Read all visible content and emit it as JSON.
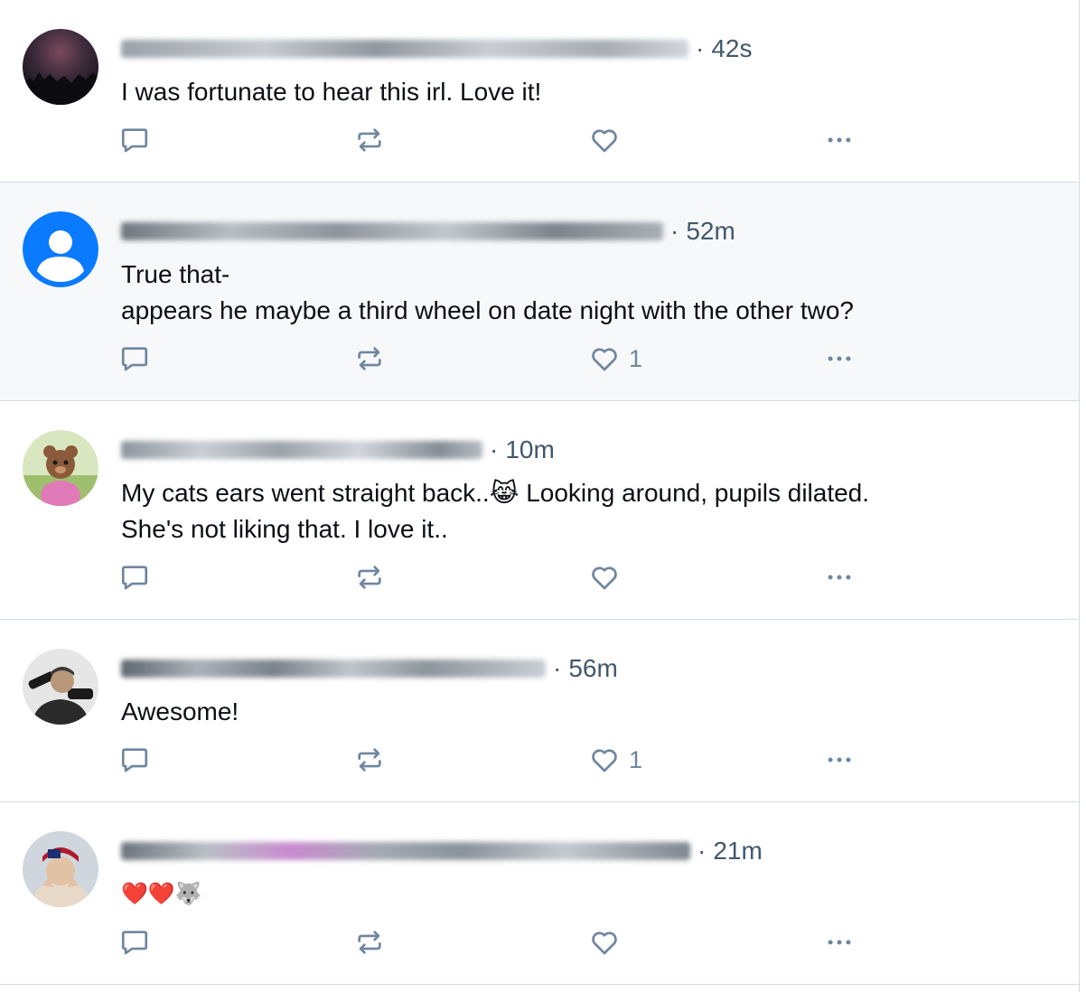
{
  "posts": [
    {
      "time": "42s",
      "text_lines": [
        "I was fortunate to hear this irl. Love it!"
      ],
      "like_count": "",
      "avatar": "night-sky-photo-avatar",
      "highlighted": false
    },
    {
      "time": "52m",
      "text_lines": [
        "True that-",
        "appears he maybe a third wheel on date night with the other two?"
      ],
      "like_count": "1",
      "avatar": "default-user-avatar",
      "highlighted": true
    },
    {
      "time": "10m",
      "text_lines": [
        "My cats ears went straight back..😹 Looking around, pupils dilated.",
        "She's not liking that. I love it.."
      ],
      "like_count": "",
      "avatar": "cartoon-character-avatar",
      "highlighted": false
    },
    {
      "time": "56m",
      "text_lines": [
        "Awesome!"
      ],
      "like_count": "1",
      "avatar": "man-with-camera-avatar",
      "highlighted": false
    },
    {
      "time": "21m",
      "text_lines": [
        "❤️❤️🐺"
      ],
      "like_count": "",
      "avatar": "person-with-flag-bandana-avatar",
      "highlighted": false
    }
  ],
  "meta_separator": "·",
  "icons": {
    "reply": "reply-icon",
    "repost": "repost-icon",
    "like": "heart-icon",
    "more": "more-icon"
  },
  "colors": {
    "icon": "#6f869f",
    "meta_text": "#42576c",
    "body_text": "#0b0f14",
    "divider": "#d4dbe2",
    "highlight_bg": "#f6f8fa",
    "default_avatar": "#0a7aff"
  }
}
